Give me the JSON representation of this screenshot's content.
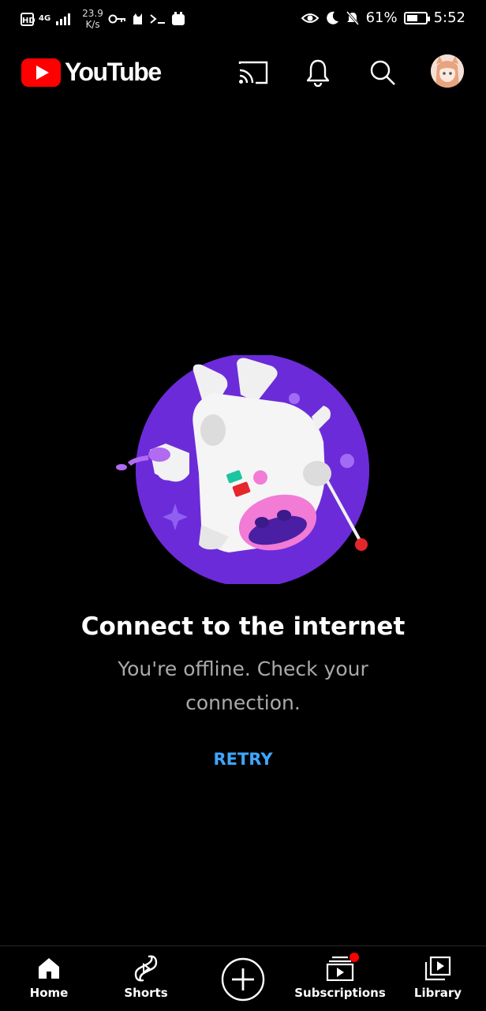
{
  "status_bar": {
    "hd_badge": "HD",
    "network": "4G",
    "speed_value": "23.9",
    "speed_unit": "K/s",
    "battery_percent": "61%",
    "battery_level": 0.61,
    "time": "5:52",
    "icons": [
      "key-icon",
      "cat-icon",
      "terminal-icon",
      "huawei-icon",
      "eye-icon",
      "moon-icon",
      "bell-off-icon",
      "battery-charging-icon"
    ]
  },
  "header": {
    "app_title": "YouTube",
    "icons": [
      "cast-icon",
      "bell-icon",
      "search-icon",
      "avatar"
    ],
    "brand_color": "#ff0000"
  },
  "offline": {
    "title": "Connect to the internet",
    "message": "You're offline. Check your connection.",
    "retry_label": "RETRY",
    "accent_color": "#3ea6ff",
    "illustration": "floating-astronaut-cow"
  },
  "bottom_nav": {
    "items": [
      {
        "label": "Home",
        "icon": "home-icon",
        "active": true
      },
      {
        "label": "Shorts",
        "icon": "shorts-icon"
      },
      {
        "label": "",
        "icon": "create-icon"
      },
      {
        "label": "Subscriptions",
        "icon": "subscriptions-icon",
        "badge": true
      },
      {
        "label": "Library",
        "icon": "library-icon"
      }
    ]
  }
}
